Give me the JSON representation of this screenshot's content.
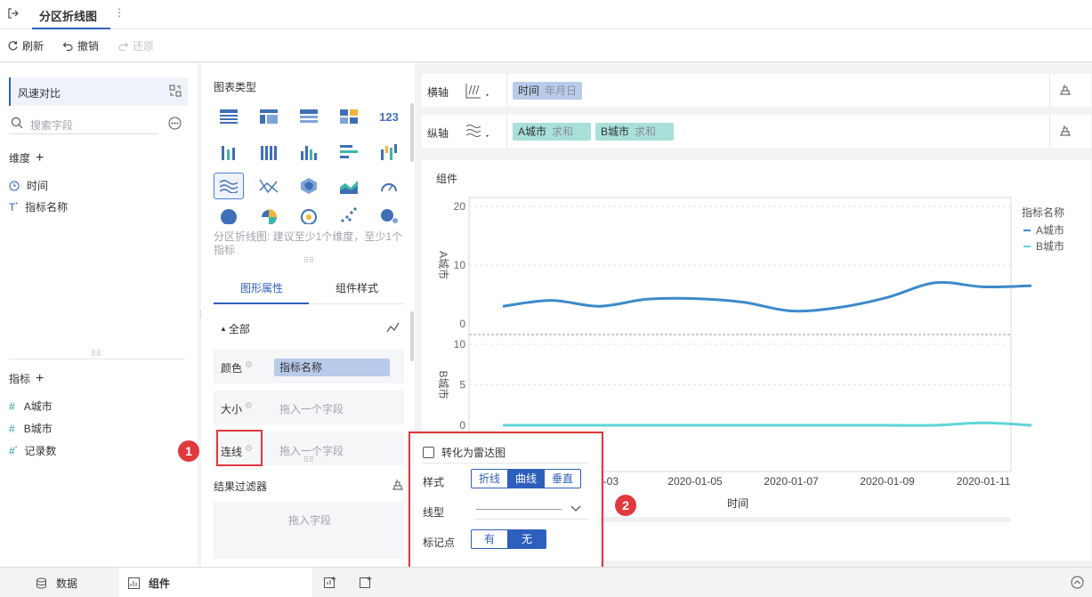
{
  "header": {
    "title": "分区折线图",
    "more_icon": "more-vertical-icon",
    "back_icon": "exit-icon"
  },
  "toolbar": {
    "refresh": "刷新",
    "undo": "撤销",
    "redo": "还原"
  },
  "dataset": {
    "name": "风速对比",
    "search_placeholder": "搜索字段"
  },
  "dimensions": {
    "title": "维度",
    "items": [
      "时间",
      "指标名称"
    ]
  },
  "measures": {
    "title": "指标",
    "items": [
      "A城市",
      "B城市",
      "记录数"
    ]
  },
  "chart_types": {
    "title": "图表类型",
    "hint": "分区折线图: 建议至少1个维度，至少1个指标"
  },
  "props_tabs": {
    "tab1": "图形属性",
    "tab2": "组件样式"
  },
  "props": {
    "all_label": "全部",
    "color_label": "颜色",
    "color_value": "指标名称",
    "size_label": "大小",
    "size_placeholder": "拖入一个字段",
    "line_label": "连线",
    "line_placeholder": "拖入一个字段"
  },
  "filter": {
    "title": "结果过滤器",
    "placeholder": "拖入字段"
  },
  "axes": {
    "x_label": "横轴",
    "x_field": "时间",
    "x_field_sub": "年月日",
    "y_label": "纵轴",
    "y_fields": [
      {
        "name": "A城市",
        "sub": "求和"
      },
      {
        "name": "B城市",
        "sub": "求和"
      }
    ]
  },
  "chart": {
    "component_label": "组件",
    "legend_title": "指标名称",
    "legend": [
      "A城市",
      "B城市"
    ],
    "colors": {
      "a": "#3d8ac9",
      "b": "#5fd5d8"
    },
    "x_title": "时间",
    "a_axis_title": "A城市",
    "b_axis_title": "B城市"
  },
  "chart_data": {
    "type": "line",
    "x": [
      "2020-01-01",
      "2020-01-02",
      "2020-01-03",
      "2020-01-04",
      "2020-01-05",
      "2020-01-06",
      "2020-01-07",
      "2020-01-08",
      "2020-01-09",
      "2020-01-10",
      "2020-01-11",
      "2020-01-12"
    ],
    "x_tick_labels": [
      "-03",
      "2020-01-05",
      "2020-01-07",
      "2020-01-09",
      "2020-01-11"
    ],
    "panels": [
      {
        "series": "A城市",
        "yticks": [
          "20",
          "10",
          "0"
        ],
        "ylim": [
          0,
          20
        ],
        "values": [
          3,
          4,
          3,
          4.2,
          4.3,
          3.7,
          2.2,
          2.8,
          4.5,
          7,
          6.3,
          6.5
        ]
      },
      {
        "series": "B城市",
        "yticks": [
          "10",
          "5",
          "0"
        ],
        "ylim": [
          0,
          10
        ],
        "values": [
          0,
          0,
          0,
          0,
          0,
          0,
          0,
          0,
          0,
          0,
          0.3,
          0
        ]
      }
    ]
  },
  "popup": {
    "radar_label": "转化为雷达图",
    "style_label": "样式",
    "style_options": [
      "折线",
      "曲线",
      "垂直"
    ],
    "style_selected": "曲线",
    "linetype_label": "线型",
    "marker_label": "标记点",
    "marker_options": [
      "有",
      "无"
    ],
    "marker_selected": "无"
  },
  "annotations": {
    "badge1": "1",
    "badge2": "2"
  },
  "bottom": {
    "data_tab": "数据",
    "component_tab": "组件"
  }
}
